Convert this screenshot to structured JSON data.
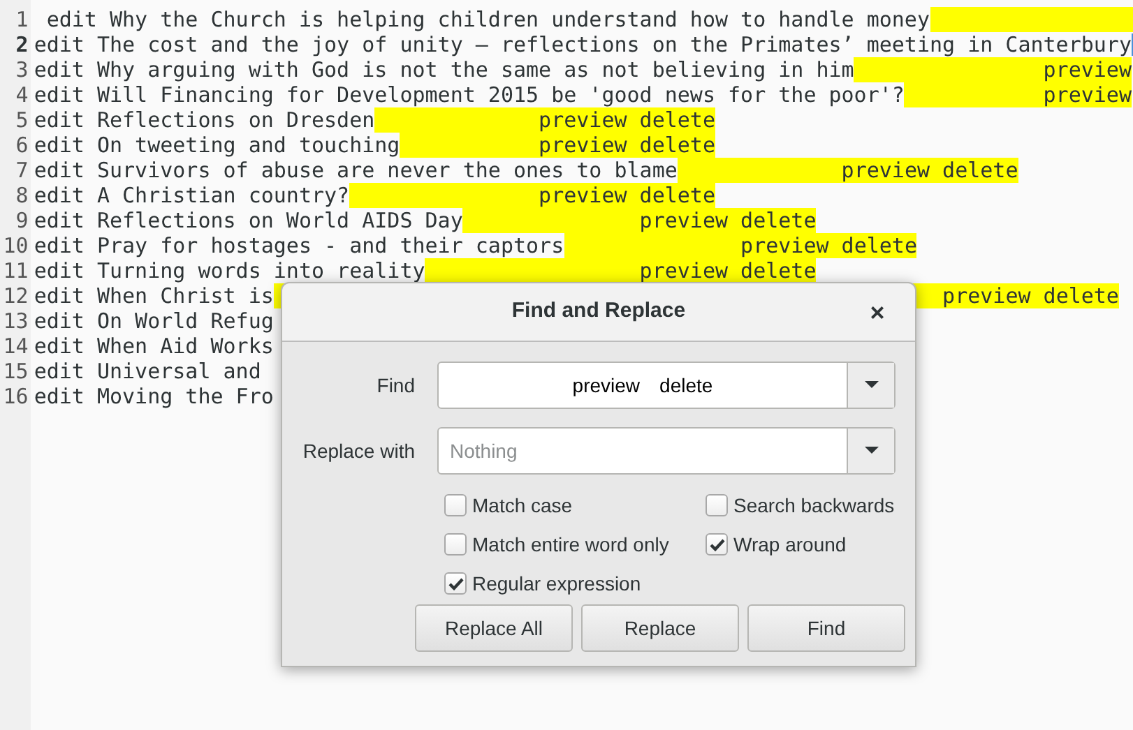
{
  "editor": {
    "lines": [
      {
        "number": "1",
        "text": " edit Why the Church is helping children understand how to handle money",
        "current": false,
        "highlighted": true
      },
      {
        "number": "2",
        "text": "edit The cost and the joy of unity — reflections on the Primates’ meeting in Canterbury",
        "current": true,
        "highlighted": false
      },
      {
        "number": "3",
        "text": "edit Why arguing with God is not the same as not believing in him",
        "current": false,
        "highlighted": true,
        "match": "               preview"
      },
      {
        "number": "4",
        "text": "edit Will Financing for Development 2015 be 'good news for the poor'?",
        "current": false,
        "highlighted": true,
        "match": "           preview"
      },
      {
        "number": "5",
        "text": "edit Reflections on Dresden",
        "current": false,
        "highlighted": true,
        "match": "             preview delete"
      },
      {
        "number": "6",
        "text": "edit On tweeting and touching",
        "current": false,
        "highlighted": true,
        "match": "           preview delete"
      },
      {
        "number": "7",
        "text": "edit Survivors of abuse are never the ones to blame",
        "current": false,
        "highlighted": true,
        "match": "             preview delete"
      },
      {
        "number": "8",
        "text": "edit A Christian country?",
        "current": false,
        "highlighted": true,
        "match": "               preview delete"
      },
      {
        "number": "9",
        "text": "edit Reflections on World AIDS Day",
        "current": false,
        "highlighted": true,
        "match": "              preview delete"
      },
      {
        "number": "10",
        "text": "edit Pray for hostages - and their captors",
        "current": false,
        "highlighted": true,
        "match": "              preview delete"
      },
      {
        "number": "11",
        "text": "edit Turning words into reality",
        "current": false,
        "highlighted": true,
        "match": "                 preview delete"
      },
      {
        "number": "12",
        "text": "edit When Christ is",
        "current": false,
        "highlighted": true,
        "match": "                                                     preview delete"
      },
      {
        "number": "13",
        "text": "edit On World Refug",
        "current": false,
        "highlighted": false
      },
      {
        "number": "14",
        "text": "edit When Aid Works",
        "current": false,
        "highlighted": false
      },
      {
        "number": "15",
        "text": "edit Universal and",
        "current": false,
        "highlighted": false
      },
      {
        "number": "16",
        "text": "edit Moving the Fro",
        "current": false,
        "highlighted": false
      }
    ]
  },
  "dialog": {
    "title": "Find and Replace",
    "close": "×",
    "find": {
      "label": "Find",
      "value": "preview\tdelete"
    },
    "replace": {
      "label": "Replace with",
      "placeholder": "Nothing"
    },
    "options": [
      {
        "label": "Match case",
        "checked": false
      },
      {
        "label": "Search backwards",
        "checked": false
      },
      {
        "label": "Match entire word only",
        "checked": false
      },
      {
        "label": "Wrap around",
        "checked": true
      },
      {
        "label": "Regular expression",
        "checked": true
      }
    ],
    "buttons": [
      "Replace All",
      "Replace",
      "Find"
    ]
  }
}
